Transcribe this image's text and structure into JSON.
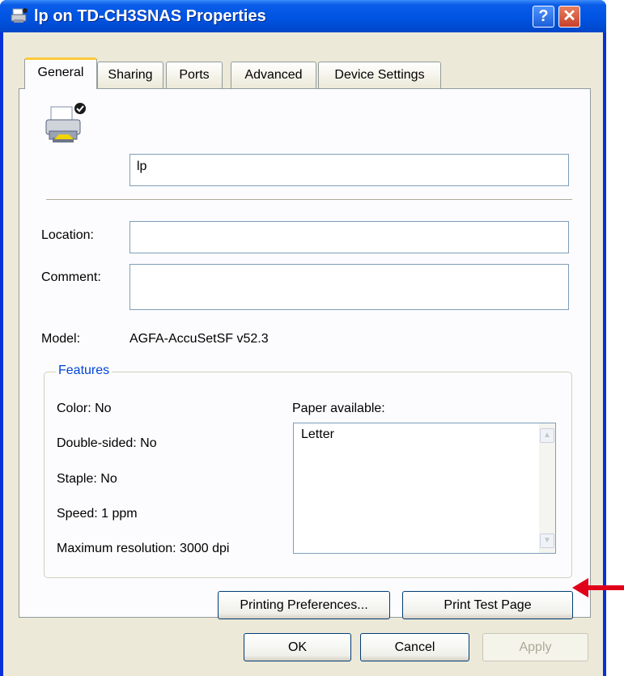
{
  "window": {
    "title": "lp on TD-CH3SNAS Properties",
    "help_label": "?",
    "close_label": "✕"
  },
  "tabs": [
    {
      "label": "General",
      "active": true
    },
    {
      "label": "Sharing",
      "active": false
    },
    {
      "label": "Ports",
      "active": false
    },
    {
      "label": "Advanced",
      "active": false
    },
    {
      "label": "Device Settings",
      "active": false
    }
  ],
  "general": {
    "printer_name": "lp",
    "location_label": "Location:",
    "location_value": "",
    "comment_label": "Comment:",
    "comment_value": "",
    "model_label": "Model:",
    "model_value": "AGFA-AccuSetSF v52.3"
  },
  "features": {
    "title": "Features",
    "color": "Color: No",
    "double_sided": "Double-sided: No",
    "staple": "Staple: No",
    "speed": "Speed: 1 ppm",
    "max_resolution": "Maximum resolution: 3000 dpi",
    "paper_label": "Paper available:",
    "paper_items": [
      "Letter"
    ]
  },
  "buttons": {
    "printing_preferences": "Printing Preferences...",
    "print_test_page": "Print Test Page",
    "ok": "OK",
    "cancel": "Cancel",
    "apply": "Apply"
  },
  "colors": {
    "titlebar": "#0054e3",
    "group_title": "#0046d5",
    "arrow": "#e0001a"
  }
}
